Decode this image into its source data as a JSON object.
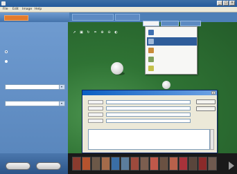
{
  "window": {
    "title": "",
    "controls": [
      "_",
      "□",
      "×"
    ]
  },
  "menubar": {
    "items": [
      "File",
      "Edit",
      "Image",
      "Help"
    ]
  },
  "top_tabs": {
    "items": [
      "",
      "",
      ""
    ]
  },
  "left_panel": {
    "instructions": "",
    "radio_options": [
      {
        "label": "",
        "selected": true
      },
      {
        "label": "",
        "selected": false
      }
    ],
    "dropdown1_label": "",
    "dropdown1_value": "",
    "dropdown2_label": "",
    "dropdown2_value": ""
  },
  "editor_tabs": [
    "",
    "",
    ""
  ],
  "context_menu": {
    "items": [
      {
        "label": "",
        "icon": "email-icon"
      },
      {
        "label": "",
        "icon": "photo-icon",
        "selected": true
      },
      {
        "label": "",
        "icon": "calendar-icon"
      },
      {
        "label": "",
        "icon": "print-icon"
      },
      {
        "label": "",
        "icon": "share-icon"
      }
    ]
  },
  "dialog": {
    "title": "",
    "field_labels": [
      "",
      "",
      "",
      ""
    ],
    "buttons": [
      "",
      ""
    ]
  },
  "bottom": {
    "left_button": "",
    "right_button": ""
  },
  "colors": {
    "accent": "#2f5d9a",
    "orange_tab": "#e37b2c",
    "panel_blue": "#5a87bd",
    "grass_green": "#2f7334"
  }
}
